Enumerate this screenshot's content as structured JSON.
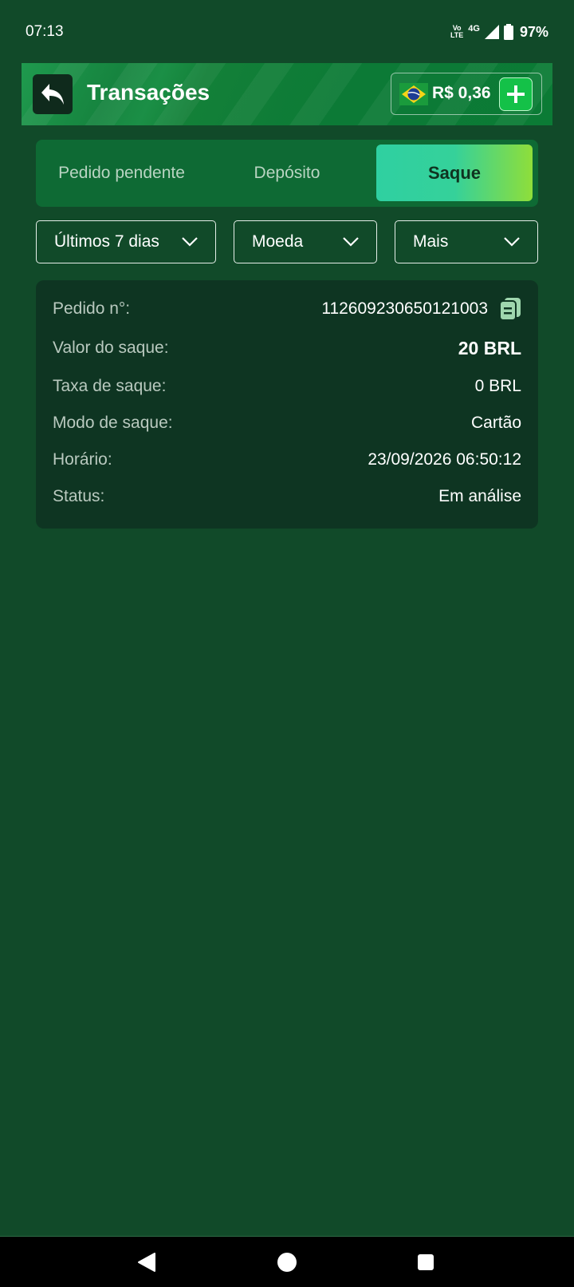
{
  "status_bar": {
    "time": "07:13",
    "volte_top": "Vo",
    "volte_bottom": "LTE",
    "network": "4G",
    "battery": "97%"
  },
  "header": {
    "title": "Transações",
    "balance": "R$ 0,36",
    "icons": {
      "back": "back-arrow-icon",
      "flag": "brazil-flag-icon",
      "add": "plus-icon"
    }
  },
  "tabs": [
    {
      "label": "Pedido pendente",
      "active": false
    },
    {
      "label": "Depósito",
      "active": false
    },
    {
      "label": "Saque",
      "active": true
    }
  ],
  "filters": {
    "period": "Últimos 7 dias",
    "currency": "Moeda",
    "more": "Mais"
  },
  "transaction": {
    "order_label": "Pedido n°:",
    "order_value": "112609230650121003",
    "amount_label": "Valor do saque:",
    "amount_value": "20 BRL",
    "fee_label": "Taxa de saque:",
    "fee_value": "0 BRL",
    "mode_label": "Modo de saque:",
    "mode_value": "Cartão",
    "time_label": "Horário:",
    "time_value": "23/09/2026 06:50:12",
    "status_label": "Status:",
    "status_value": "Em análise"
  },
  "colors": {
    "background": "#114a29",
    "header": "#0b7b35",
    "card": "#0e3522",
    "active_tab_start": "#2fd0a1",
    "active_tab_end": "#8fde3a",
    "add_button": "#14c148"
  }
}
